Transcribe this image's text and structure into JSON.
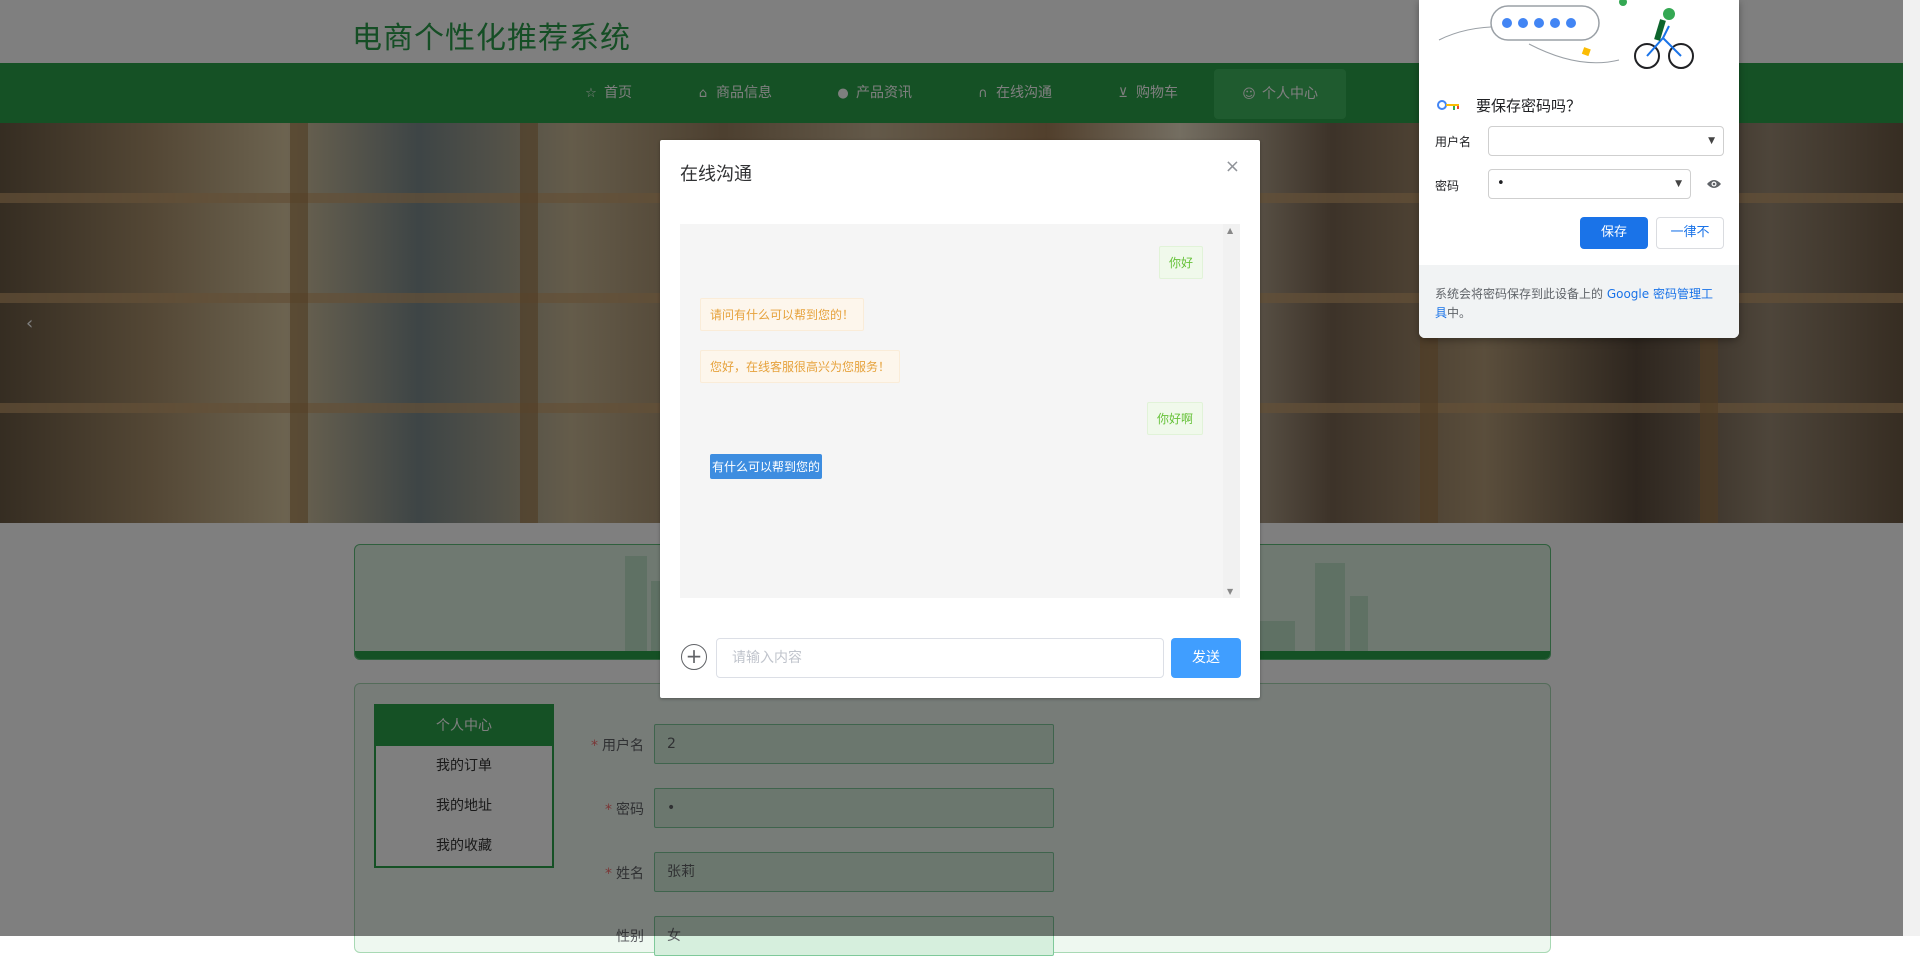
{
  "header": {
    "site_title": "电商个性化推荐系统"
  },
  "nav": {
    "items": [
      {
        "label": "首页",
        "icon": "star-icon"
      },
      {
        "label": "商品信息",
        "icon": "bag-icon"
      },
      {
        "label": "产品资讯",
        "icon": "info-icon"
      },
      {
        "label": "在线沟通",
        "icon": "headset-icon"
      },
      {
        "label": "购物车",
        "icon": "cart-icon"
      },
      {
        "label": "个人中心",
        "icon": "user-icon"
      }
    ],
    "active_index": 5
  },
  "banner": {
    "prev_arrow": "‹"
  },
  "profile": {
    "menu": [
      "个人中心",
      "我的订单",
      "我的地址",
      "我的收藏"
    ],
    "fields": [
      {
        "label": "用户名",
        "value": "2"
      },
      {
        "label": "密码",
        "value": "•"
      },
      {
        "label": "姓名",
        "value": "张莉"
      },
      {
        "label": "性别",
        "value": "女"
      }
    ]
  },
  "chat_dialog": {
    "title": "在线沟通",
    "close": "×",
    "messages": [
      {
        "from": "me",
        "text": "你好"
      },
      {
        "from": "cs",
        "text": "请问有什么可以帮到您的！"
      },
      {
        "from": "cs",
        "text": "您好，在线客服很高兴为您服务！"
      },
      {
        "from": "me",
        "text": "你好啊"
      },
      {
        "from": "selected",
        "text": "有什么可以帮到您的"
      }
    ],
    "input_placeholder": "请输入内容",
    "send_label": "发送"
  },
  "password_popup": {
    "title": "要保存密码吗？",
    "username_label": "用户名",
    "username_value": "",
    "password_label": "密码",
    "password_value": "•",
    "save_label": "保存",
    "never_label": "一律不",
    "footer_prefix": "系统会将密码保存到此设备上的 ",
    "footer_link": "Google 密码管理工具",
    "footer_suffix": "中。"
  },
  "colors": {
    "brand_green": "#2aa24a",
    "send_blue": "#409eff",
    "chrome_blue": "#1a73e8"
  }
}
